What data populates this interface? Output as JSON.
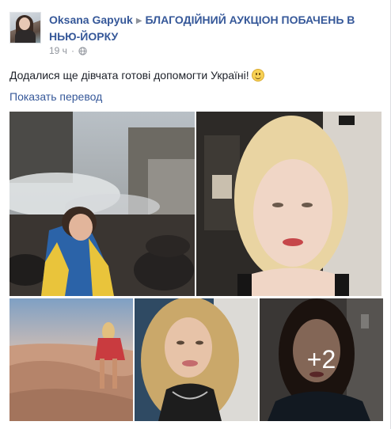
{
  "post": {
    "author": "Oksana Gapyuk",
    "group": "БЛАГОДІЙНИЙ АУКЦІОН ПОБАЧЕНЬ В НЬЮ-ЙОРКУ",
    "timestamp": "19 ч",
    "dot": "·",
    "privacy_icon": "globe-icon",
    "text": "Додалися ще дівчата готові допомогти Україні!",
    "emoji": "smiley-emoji",
    "translate_link": "Показать перевод",
    "more_photos_label": "+2"
  },
  "colors": {
    "link": "#365899",
    "text": "#1d2129",
    "meta": "#90949c"
  }
}
